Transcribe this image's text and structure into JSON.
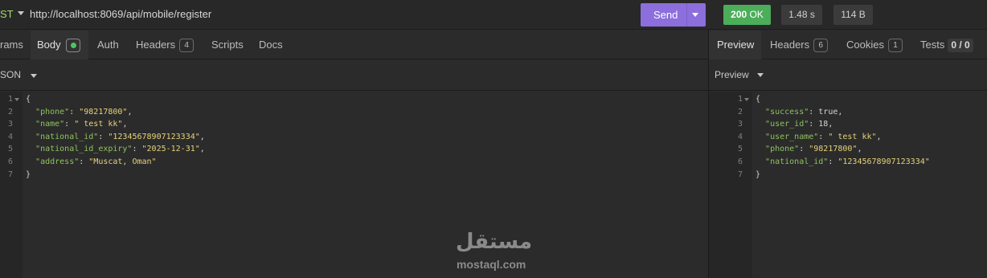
{
  "request": {
    "method": "ST",
    "url": "http://localhost:8069/api/mobile/register",
    "send_label": "Send"
  },
  "response_meta": {
    "status_code": "200",
    "status_text": "OK",
    "time": "1.48 s",
    "size": "114 B"
  },
  "request_tabs": [
    {
      "label": "rams"
    },
    {
      "label": "Body"
    },
    {
      "label": "Auth"
    },
    {
      "label": "Headers",
      "badge": "4"
    },
    {
      "label": "Scripts"
    },
    {
      "label": "Docs"
    }
  ],
  "response_tabs": [
    {
      "label": "Preview"
    },
    {
      "label": "Headers",
      "badge": "6"
    },
    {
      "label": "Cookies",
      "badge": "1"
    },
    {
      "label": "Tests",
      "score": "0 / 0"
    }
  ],
  "body_format": "SON",
  "preview_mode": "Preview",
  "request_body_lines": [
    {
      "n": "1",
      "open": "{"
    },
    {
      "n": "2",
      "key": "\"phone\"",
      "val": "\"98217800\"",
      "str": true,
      "tail": ","
    },
    {
      "n": "3",
      "key": "\"name\"",
      "val": "\" test kk\"",
      "str": true,
      "tail": ","
    },
    {
      "n": "4",
      "key": "\"national_id\"",
      "val": "\"12345678907123334\"",
      "str": true,
      "tail": ","
    },
    {
      "n": "5",
      "key": "\"national_id_expiry\"",
      "val": "\"2025-12-31\"",
      "str": true,
      "tail": ","
    },
    {
      "n": "6",
      "key": "\"address\"",
      "val": "\"Muscat, Oman\"",
      "str": true,
      "tail": ""
    },
    {
      "n": "7",
      "open": "}"
    }
  ],
  "response_body_lines": [
    {
      "n": "1",
      "open": "{"
    },
    {
      "n": "2",
      "key": "\"success\"",
      "val": "true",
      "str": false,
      "tail": ","
    },
    {
      "n": "3",
      "key": "\"user_id\"",
      "val": "18",
      "str": false,
      "tail": ","
    },
    {
      "n": "4",
      "key": "\"user_name\"",
      "val": "\" test kk\"",
      "str": true,
      "tail": ","
    },
    {
      "n": "5",
      "key": "\"phone\"",
      "val": "\"98217800\"",
      "str": true,
      "tail": ","
    },
    {
      "n": "6",
      "key": "\"national_id\"",
      "val": "\"12345678907123334\"",
      "str": true,
      "tail": ""
    },
    {
      "n": "7",
      "open": "}"
    }
  ],
  "watermark": {
    "arabic": "مستقل",
    "latin": "mostaql.com"
  },
  "colors": {
    "send": "#8c6fdc",
    "status_ok": "#4cad5a",
    "json_key": "#8fc25e",
    "json_string": "#e6d27a"
  }
}
